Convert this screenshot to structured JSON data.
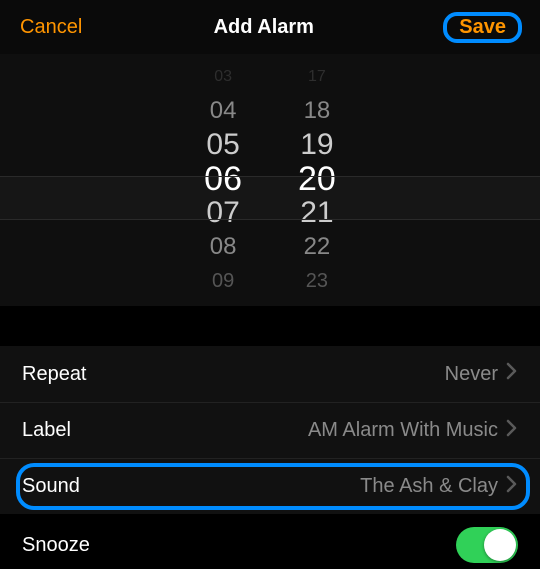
{
  "header": {
    "cancel": "Cancel",
    "title": "Add Alarm",
    "save": "Save"
  },
  "picker": {
    "hours": [
      "03",
      "04",
      "05",
      "06",
      "07",
      "08",
      "09"
    ],
    "minutes": [
      "17",
      "18",
      "19",
      "20",
      "21",
      "22",
      "23"
    ],
    "selected_hour": "06",
    "selected_minute": "20"
  },
  "rows": {
    "repeat": {
      "label": "Repeat",
      "value": "Never"
    },
    "label": {
      "label": "Label",
      "value": "AM Alarm With Music"
    },
    "sound": {
      "label": "Sound",
      "value": "The Ash & Clay"
    },
    "snooze": {
      "label": "Snooze",
      "on": true
    }
  },
  "colors": {
    "accent": "#ff9500",
    "highlight": "#008cff",
    "switch_on": "#30d158"
  }
}
